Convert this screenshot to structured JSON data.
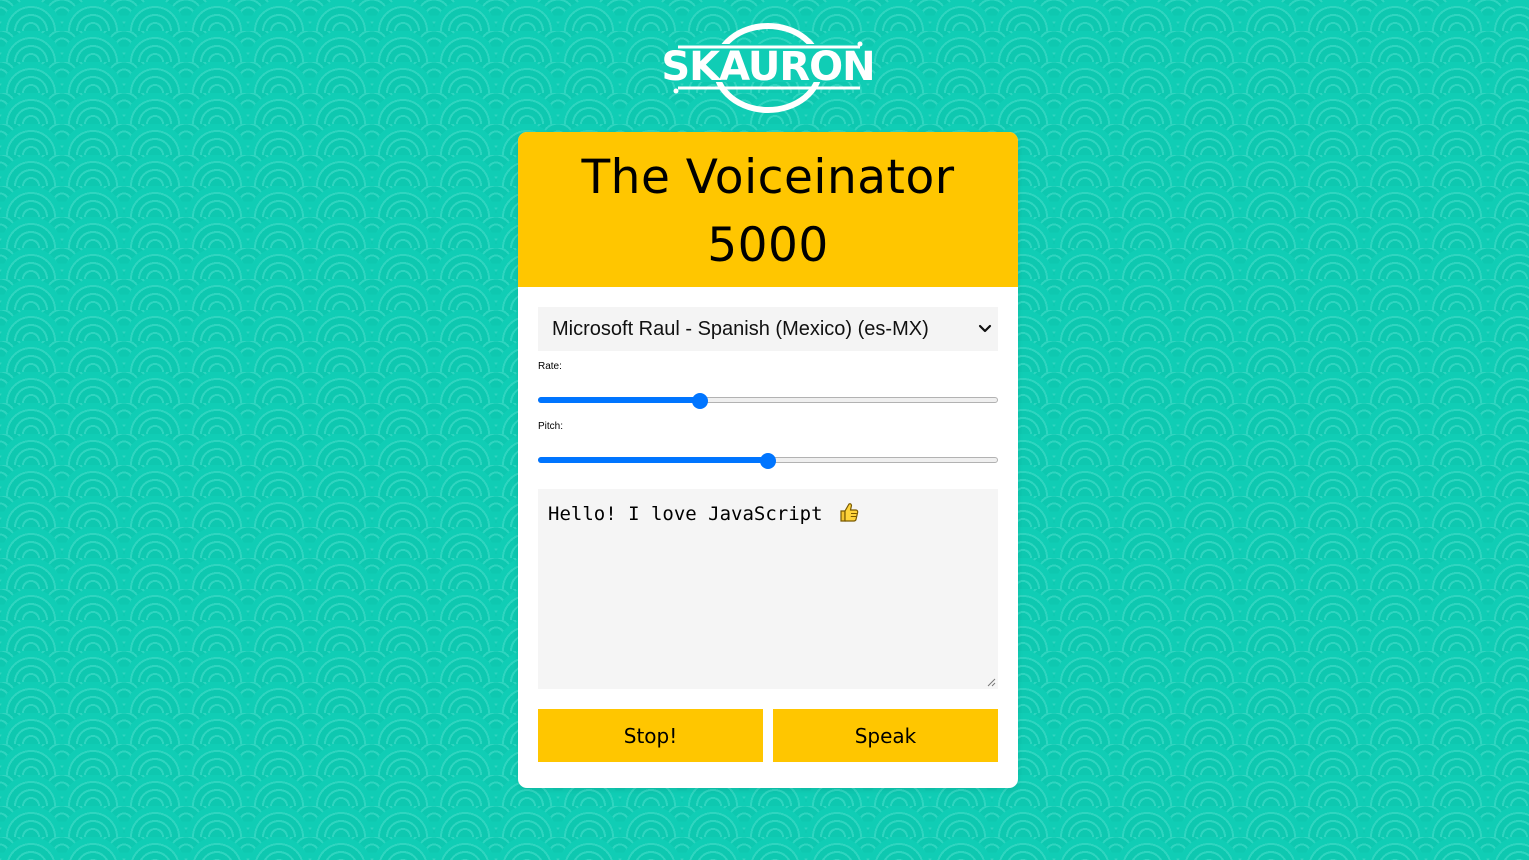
{
  "brand": {
    "logo_text": "SKAURON"
  },
  "app": {
    "title": "The Voiceinator 5000",
    "voice_select": {
      "selected": "Microsoft Raul - Spanish (Mexico) (es-MX)"
    },
    "rate": {
      "label": "Rate:",
      "value_fraction": 0.346
    },
    "pitch": {
      "label": "Pitch:",
      "value_fraction": 0.5
    },
    "message": {
      "text": "Hello! I love JavaScript"
    },
    "buttons": {
      "stop_label": "Stop!",
      "speak_label": "Speak"
    }
  },
  "colors": {
    "background": "#10cdb5",
    "accent": "#ffc600",
    "slider": "#0075ff"
  },
  "icons": {
    "select": "chevron-down-icon",
    "emoji": "thumbs-up-icon",
    "resize": "resize-grip-icon"
  }
}
